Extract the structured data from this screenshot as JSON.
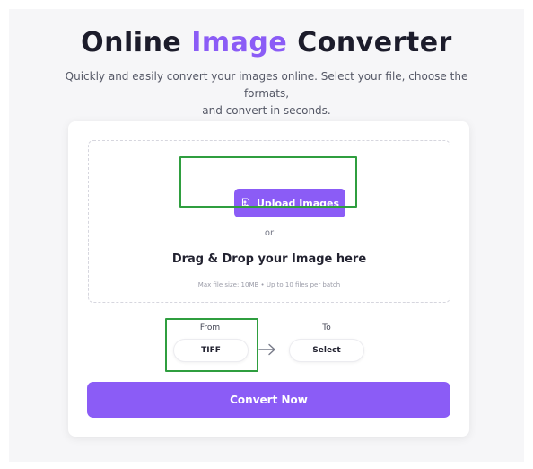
{
  "header": {
    "title_part1": "Online",
    "title_accent": "Image",
    "title_part2": "Converter",
    "subtitle_line1": "Quickly and easily convert your images online. Select your file, choose the formats,",
    "subtitle_line2": "and convert in seconds."
  },
  "upload": {
    "button_label": "Upload Images",
    "button_icon": "image-file-icon",
    "or_label": "or",
    "drag_label": "Drag & Drop your Image here",
    "limits_label": "Max file size: 10MB • Up to 10 files per batch"
  },
  "format": {
    "from_label": "From",
    "from_value": "TIFF",
    "to_label": "To",
    "to_value": "Select",
    "arrow_icon": "arrow-right-icon"
  },
  "actions": {
    "convert_label": "Convert Now"
  },
  "colors": {
    "accent": "#8b5cf6",
    "highlight": "#2f9e3f"
  }
}
